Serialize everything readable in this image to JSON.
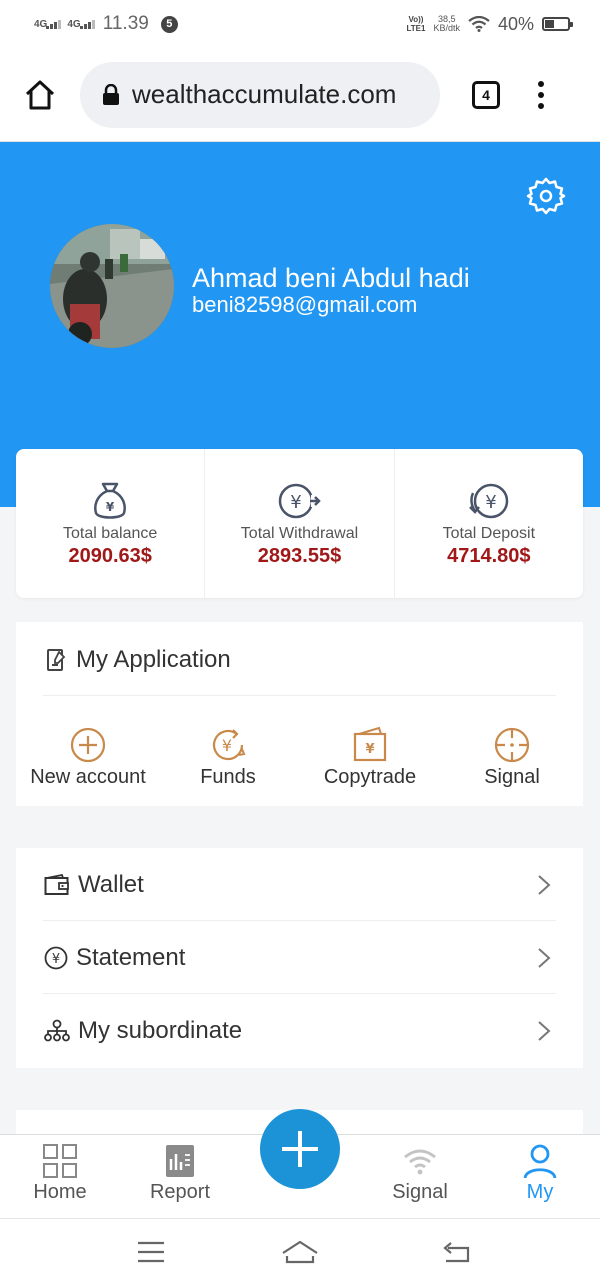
{
  "status_bar": {
    "network1": "4G",
    "network2": "4G",
    "time": "11.39",
    "notification_count": "5",
    "volte_line1": "Vo))",
    "volte_line2": "LTE1",
    "speed_value": "38,5",
    "speed_unit": "KB/dtk",
    "battery": "40%"
  },
  "browser": {
    "url": "wealthaccumulate.com",
    "tab_count": "4"
  },
  "profile": {
    "name": "Ahmad beni Abdul hadi",
    "email": "beni82598@gmail.com"
  },
  "stats": [
    {
      "label": "Total balance",
      "value": "2090.63$",
      "icon": "money-bag-icon"
    },
    {
      "label": "Total Withdrawal",
      "value": "2893.55$",
      "icon": "withdraw-icon"
    },
    {
      "label": "Total Deposit",
      "value": "4714.80$",
      "icon": "deposit-icon"
    }
  ],
  "application": {
    "title": "My Application",
    "items": [
      {
        "label": "New account",
        "icon": "plus-circle-icon"
      },
      {
        "label": "Funds",
        "icon": "funds-icon"
      },
      {
        "label": "Copytrade",
        "icon": "copytrade-icon"
      },
      {
        "label": "Signal",
        "icon": "crosshair-icon"
      }
    ]
  },
  "menu": [
    {
      "label": "Wallet",
      "icon": "wallet-icon"
    },
    {
      "label": "Statement",
      "icon": "yen-circle-icon"
    },
    {
      "label": "My subordinate",
      "icon": "hierarchy-icon"
    }
  ],
  "bottom_nav": [
    {
      "label": "Home",
      "icon": "grid-icon"
    },
    {
      "label": "Report",
      "icon": "report-icon"
    },
    {
      "label": "Signal",
      "icon": "wifi-icon"
    },
    {
      "label": "My",
      "icon": "person-icon",
      "active": true
    }
  ],
  "colors": {
    "header_blue": "#2196f3",
    "value_red": "#a01818",
    "fab_blue": "#1c93d6",
    "accent_orange": "#c9894a"
  }
}
